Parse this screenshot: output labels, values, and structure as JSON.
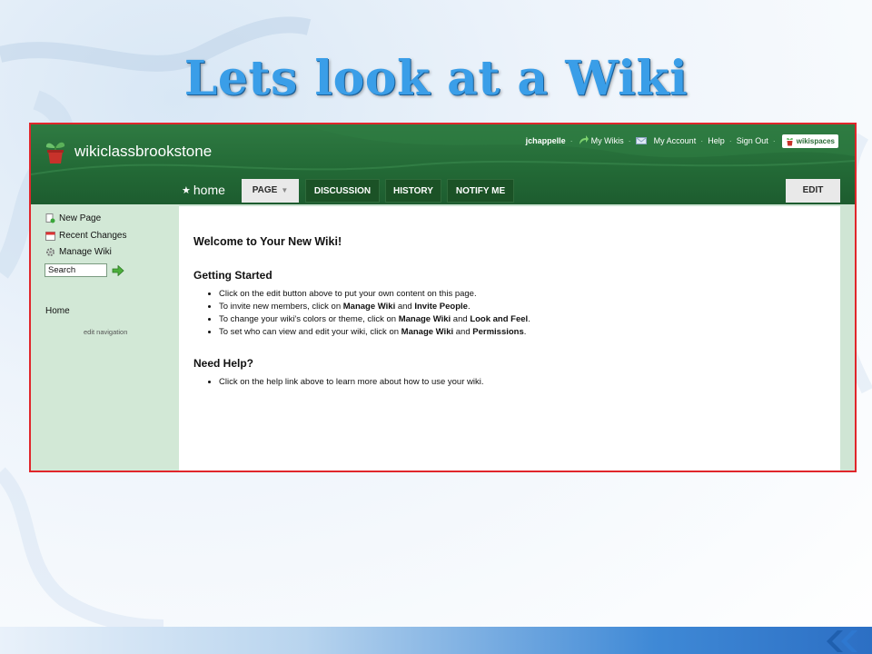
{
  "slide": {
    "title": "Lets look at a Wiki"
  },
  "wiki": {
    "name": "wikiclassbrookstone",
    "top_links": {
      "user": "jchappelle",
      "my_wikis": "My Wikis",
      "my_account": "My Account",
      "help": "Help",
      "sign_out": "Sign Out",
      "logo_text": "wikispaces"
    },
    "home_tab": "home",
    "tabs": {
      "page": "PAGE",
      "discussion": "DISCUSSION",
      "history": "HISTORY",
      "notify": "NOTIFY ME",
      "edit": "EDIT"
    },
    "sidebar": {
      "new_page": "New Page",
      "recent_changes": "Recent Changes",
      "manage_wiki": "Manage Wiki",
      "search_value": "Search",
      "home": "Home",
      "edit_navigation": "edit navigation"
    },
    "content": {
      "welcome": "Welcome to Your New Wiki!",
      "getting_started": "Getting Started",
      "gs_items": [
        {
          "pre": "Click on the edit button above to put your own content on this page.",
          "b1": "",
          "mid": "",
          "b2": "",
          "post": ""
        },
        {
          "pre": "To invite new members, click on ",
          "b1": "Manage Wiki",
          "mid": " and ",
          "b2": "Invite People",
          "post": "."
        },
        {
          "pre": "To change your wiki's colors or theme, click on ",
          "b1": "Manage Wiki",
          "mid": " and ",
          "b2": "Look and Feel",
          "post": "."
        },
        {
          "pre": "To set who can view and edit your wiki, click on ",
          "b1": "Manage Wiki",
          "mid": " and ",
          "b2": "Permissions",
          "post": "."
        }
      ],
      "need_help": "Need Help?",
      "help_items": [
        {
          "pre": "Click on the help link above to learn more about how to use your wiki."
        }
      ]
    },
    "colors": {
      "header_green": "#236a36",
      "frame_red": "#e0262b",
      "sidebar_green": "#d2e8d6",
      "title_blue": "#3a9ee8"
    }
  }
}
